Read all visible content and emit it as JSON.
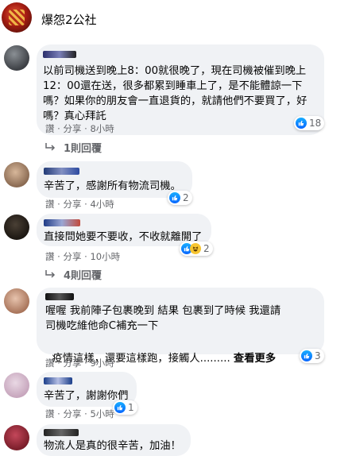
{
  "page": {
    "name": "爆怨2公社"
  },
  "actions": {
    "like": "讚",
    "share": "分享"
  },
  "comments": [
    {
      "text": "以前司機送到晚上8：00就很晚了，現在司機被催到晚上12：00還在送，很多都累到睡車上了，是不能體諒一下嗎？如果你的朋友會一直退貨的，就請他們不要買了，好嗎？真心拜託",
      "time": "8小時",
      "reaction_count": "18",
      "replies": "1則回覆"
    },
    {
      "text": "辛苦了，感謝所有物流司機。",
      "time": "4小時",
      "reaction_count": "2"
    },
    {
      "text": "直接問她要不要收，不收就離開了",
      "time": "10小時",
      "reaction_count": "2",
      "replies": "4則回覆"
    },
    {
      "text": "喔喔 我前陣子包裹晚到 結果 包裹到了時候 我還請司機吃維他命C補充一下",
      "text2": "疫情這樣，還要這樣跑，接觸人.........",
      "see_more": "查看更多",
      "time": "9小時",
      "reaction_count": "3"
    },
    {
      "text": "辛苦了，謝謝你們",
      "time": "5小時",
      "reaction_count": "1"
    },
    {
      "text": "物流人是真的很辛苦，加油！"
    }
  ],
  "colors": {
    "link_blue": "#0866ff",
    "bubble_bg": "#f0f2f5",
    "meta_gray": "#65676b"
  }
}
